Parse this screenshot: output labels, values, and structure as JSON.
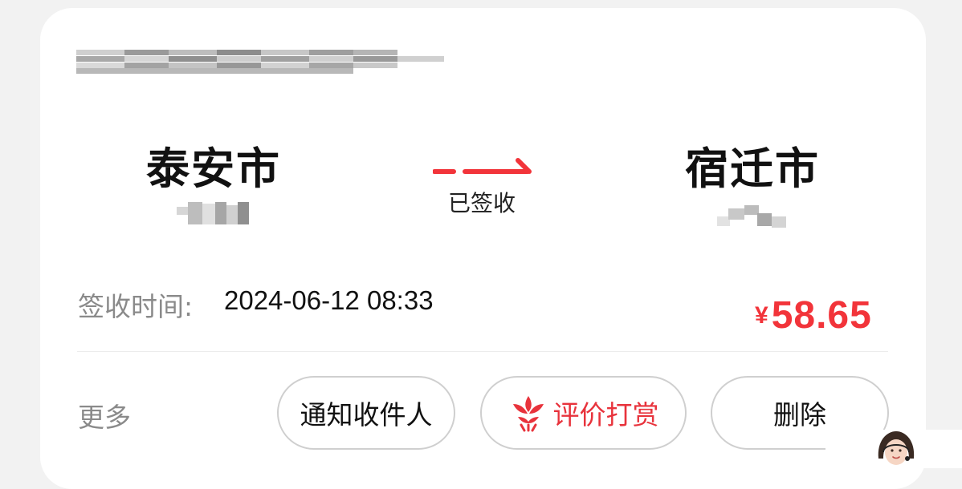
{
  "order": {
    "tracking_number": "",
    "from_city": "泰安市",
    "from_district": "",
    "to_city": "宿迁市",
    "to_district": "",
    "status": "已签收",
    "sign_time_label": "签收时间:",
    "sign_time_value": "2024-06-12 08:33",
    "price_currency": "¥",
    "price_amount": "58.65"
  },
  "actions": {
    "more_label": "更多",
    "notify_label": "通知收件人",
    "review_label": "评价打赏",
    "delete_label": "删除"
  },
  "icons": {
    "arrow": "right-arrow-icon",
    "review": "flower-icon",
    "support": "customer-service-avatar-icon"
  },
  "colors": {
    "accent": "#f2343a",
    "review_text": "#e8333c",
    "muted_text": "#8a8a8a",
    "button_border": "#cfcfcf"
  }
}
